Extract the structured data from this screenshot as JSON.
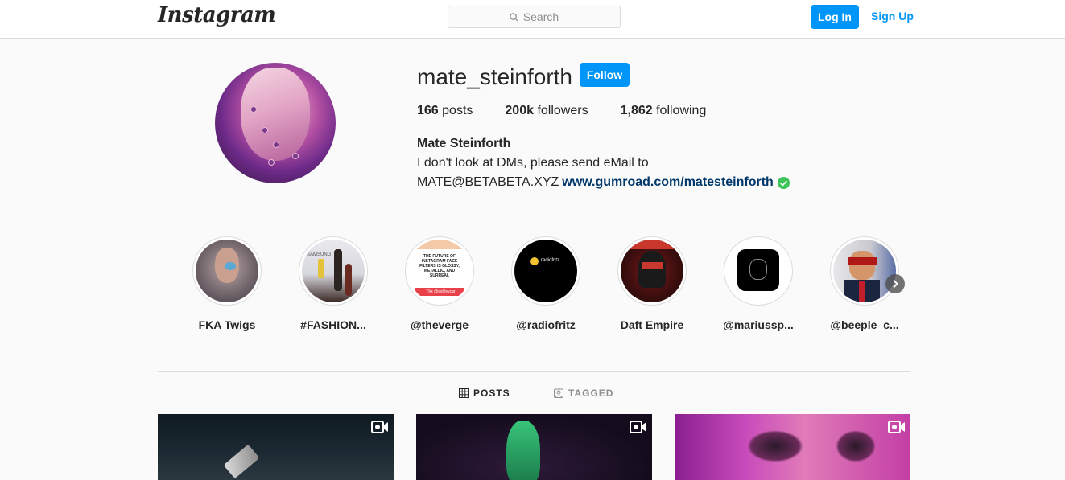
{
  "nav": {
    "logo": "Instagram",
    "search_placeholder": "Search",
    "login_label": "Log In",
    "signup_label": "Sign Up"
  },
  "profile": {
    "username": "mate_steinforth",
    "follow_label": "Follow",
    "stats": {
      "posts_count": "166",
      "posts_label": "posts",
      "followers_count": "200k",
      "followers_label": "followers",
      "following_count": "1,862",
      "following_label": "following"
    },
    "full_name": "Mate Steinforth",
    "bio_line1": "I don't look at DMs, please send eMail to",
    "bio_line2": "MATE@BETABETA.XYZ",
    "bio_link": "www.gumroad.com/matesteinforth"
  },
  "highlights": [
    {
      "label": "FKA Twigs"
    },
    {
      "label": "#FASHION..."
    },
    {
      "label": "@theverge"
    },
    {
      "label": "@radiofritz"
    },
    {
      "label": "Daft Empire"
    },
    {
      "label": "@mariussp..."
    },
    {
      "label": "@beeple_c..."
    }
  ],
  "highlight_texts": {
    "samsung": "SAMSUNG",
    "verge_headline": "THE FUTURE OF INSTAGRAM FACE FILTERS IS GLOSSY, METALLIC, AND SURREAL",
    "verge_handle": "Thx @ashleycar",
    "radiofritz": "radiofritz"
  },
  "tabs": {
    "posts_label": "POSTS",
    "tagged_label": "TAGGED"
  },
  "colors": {
    "accent": "#0095f6",
    "link": "#00376b",
    "verified": "#3fc45a"
  }
}
